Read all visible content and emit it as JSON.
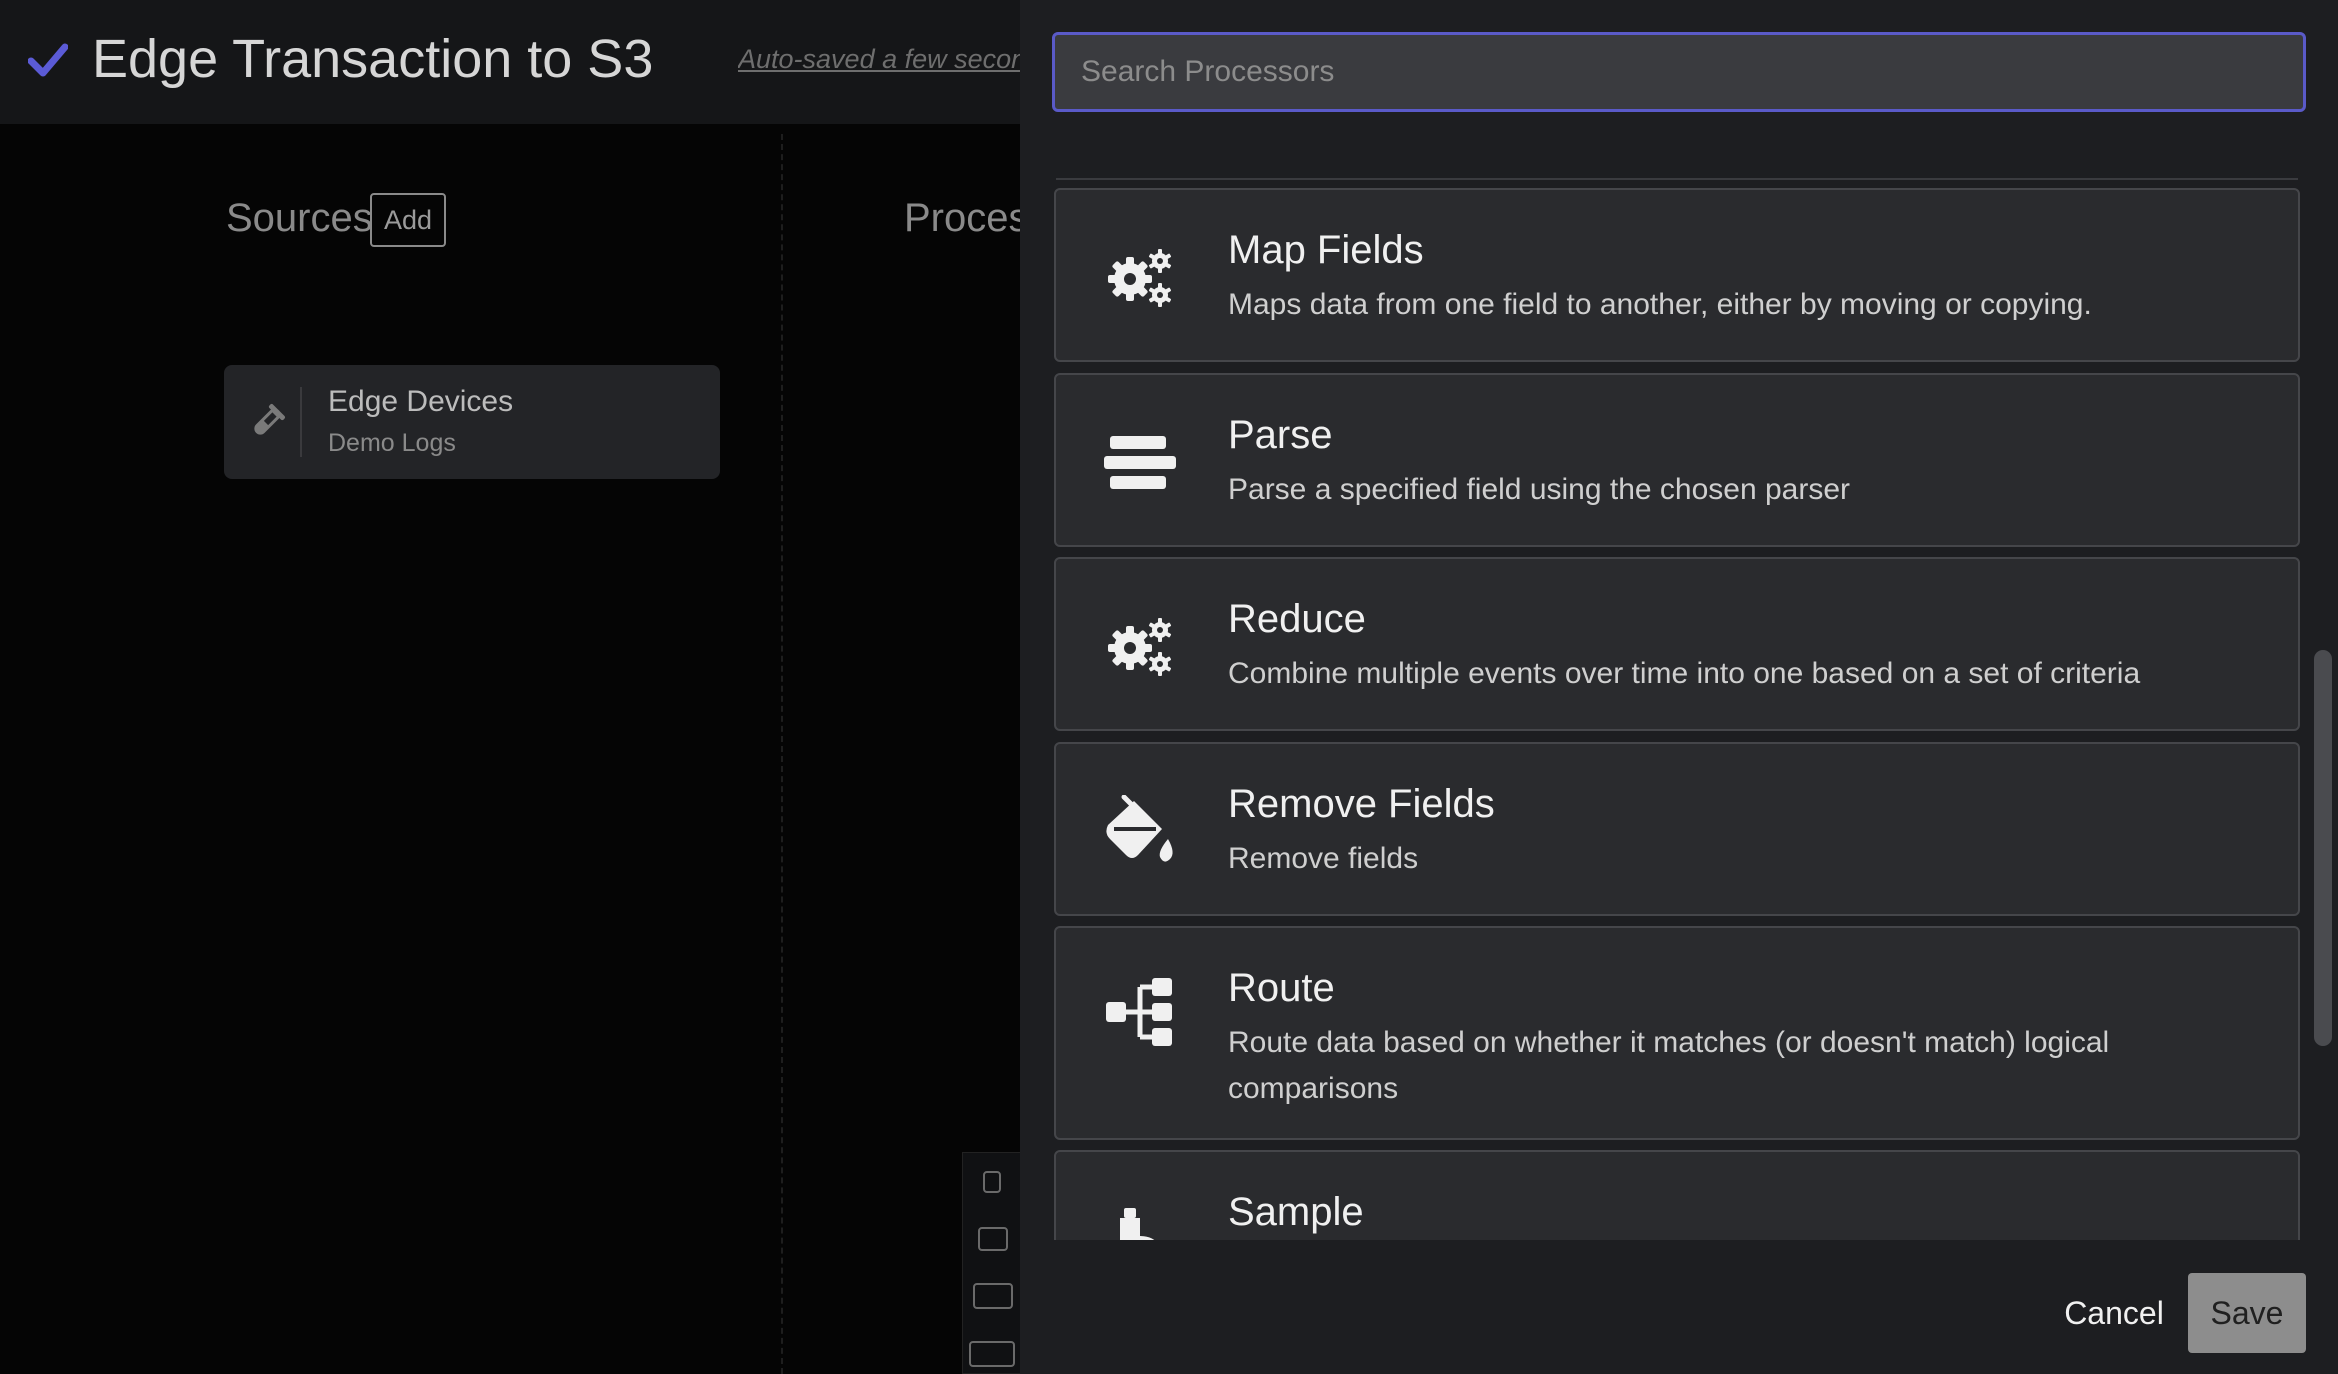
{
  "header": {
    "title": "Edge Transaction to S3",
    "autosave_text": "Auto-saved a few seconds ago",
    "check_icon": "check-icon"
  },
  "canvas": {
    "sources_heading": "Sources",
    "add_label": "Add",
    "processors_heading": "Processors",
    "source_card": {
      "name": "Edge Devices",
      "subtitle": "Demo Logs",
      "icon": "test-tube-icon"
    }
  },
  "drawer": {
    "search_placeholder": "Search Processors",
    "items": [
      {
        "name": "Map Fields",
        "description": "Maps data from one field to another, either by moving or copying.",
        "icon": "gears-icon"
      },
      {
        "name": "Parse",
        "description": "Parse a specified field using the chosen parser",
        "icon": "lines-icon"
      },
      {
        "name": "Reduce",
        "description": "Combine multiple events over time into one based on a set of criteria",
        "icon": "gears-icon"
      },
      {
        "name": "Remove Fields",
        "description": "Remove fields",
        "icon": "fill-bucket-icon"
      },
      {
        "name": "Route",
        "description": "Route data based on whether it matches (or doesn't match) logical comparisons",
        "icon": "sitemap-icon"
      },
      {
        "name": "Sample",
        "description": "",
        "icon": "flask-icon"
      }
    ],
    "cancel_label": "Cancel",
    "save_label": "Save"
  },
  "colors": {
    "accent": "#5a5ac8",
    "check": "#5b5bd6",
    "drawer_bg": "#1d1e21",
    "card_bg": "#2a2b2e"
  }
}
